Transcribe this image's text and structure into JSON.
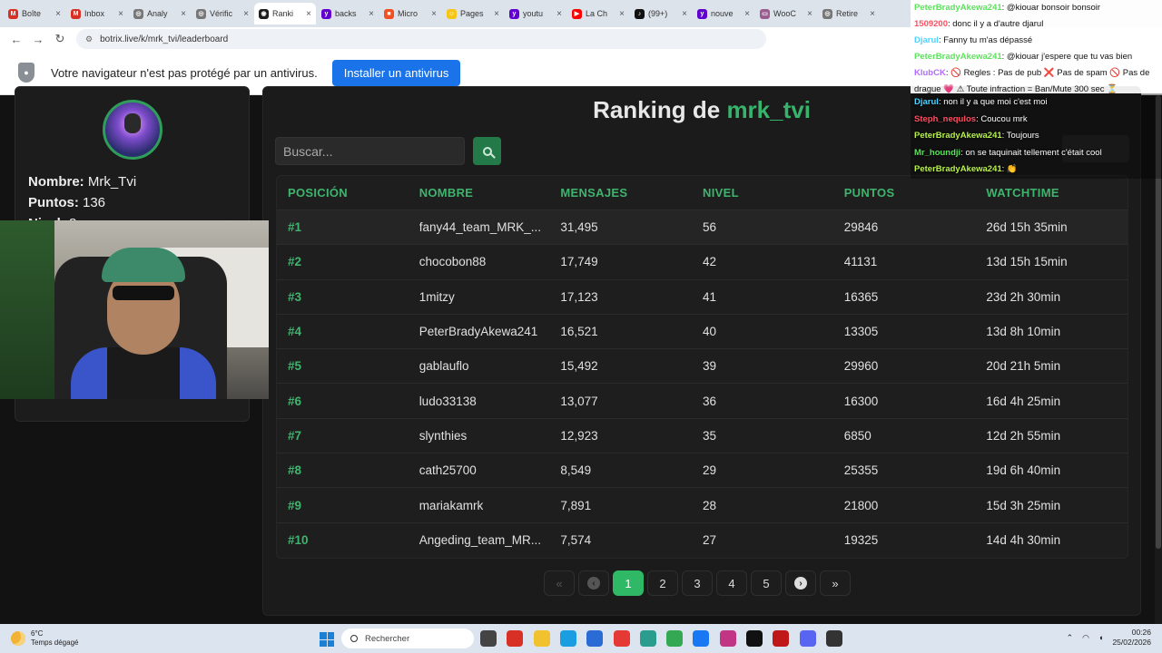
{
  "browser": {
    "tabs": [
      {
        "label": "Boîte",
        "fav_color": "#d93025",
        "glyph": "M"
      },
      {
        "label": "Inbox",
        "fav_color": "#d93025",
        "glyph": "M"
      },
      {
        "label": "Analy",
        "fav_color": "#777777",
        "glyph": "◎"
      },
      {
        "label": "Vérific",
        "fav_color": "#777777",
        "glyph": "◎"
      },
      {
        "label": "Ranki",
        "fav_color": "#1d1d1d",
        "glyph": "◉",
        "active": true
      },
      {
        "label": "backs",
        "fav_color": "#6001d2",
        "glyph": "y"
      },
      {
        "label": "Micro",
        "fav_color": "#f25022",
        "glyph": "■"
      },
      {
        "label": "Pages",
        "fav_color": "#f5c518",
        "glyph": "☺"
      },
      {
        "label": "youtu",
        "fav_color": "#6001d2",
        "glyph": "y"
      },
      {
        "label": "La Ch",
        "fav_color": "#ff0000",
        "glyph": "▶"
      },
      {
        "label": "(99+)",
        "fav_color": "#111111",
        "glyph": "♪"
      },
      {
        "label": "nouve",
        "fav_color": "#6001d2",
        "glyph": "y"
      },
      {
        "label": "WooC",
        "fav_color": "#9b5c8f",
        "glyph": "▭"
      },
      {
        "label": "Retire",
        "fav_color": "#777777",
        "glyph": "◎"
      }
    ],
    "url": "botrix.live/k/mrk_tvi/leaderboard"
  },
  "warning": {
    "text": "Votre navigateur n'est pas protégé par un antivirus.",
    "button": "Installer un antivirus"
  },
  "profile": {
    "name_label": "Nombre:",
    "name_value": "Mrk_Tvi",
    "points_label": "Puntos:",
    "points_value": "136",
    "level_label": "Nivel:",
    "level_value": "8"
  },
  "ranking": {
    "title_prefix": "Ranking de",
    "user": "mrk_tvi",
    "search_placeholder": "Buscar...",
    "headers": [
      "POSICIÓN",
      "NOMBRE",
      "MENSAJES",
      "NIVEL",
      "PUNTOS",
      "WATCHTIME"
    ],
    "rows": [
      {
        "pos": "#1",
        "name": "fany44_team_MRK_...",
        "msgs": "31,495",
        "level": "56",
        "points": "29846",
        "watch": "26d 15h 35min"
      },
      {
        "pos": "#2",
        "name": "chocobon88",
        "msgs": "17,749",
        "level": "42",
        "points": "41131",
        "watch": "13d 15h 15min"
      },
      {
        "pos": "#3",
        "name": "1mitzy",
        "msgs": "17,123",
        "level": "41",
        "points": "16365",
        "watch": "23d 2h 30min"
      },
      {
        "pos": "#4",
        "name": "PeterBradyAkewa241",
        "msgs": "16,521",
        "level": "40",
        "points": "13305",
        "watch": "13d 8h 10min"
      },
      {
        "pos": "#5",
        "name": "gablauflo",
        "msgs": "15,492",
        "level": "39",
        "points": "29960",
        "watch": "20d 21h 5min"
      },
      {
        "pos": "#6",
        "name": "ludo33138",
        "msgs": "13,077",
        "level": "36",
        "points": "16300",
        "watch": "16d 4h 25min"
      },
      {
        "pos": "#7",
        "name": "slynthies",
        "msgs": "12,923",
        "level": "35",
        "points": "6850",
        "watch": "12d 2h 55min"
      },
      {
        "pos": "#8",
        "name": "cath25700",
        "msgs": "8,549",
        "level": "29",
        "points": "25355",
        "watch": "19d 6h 40min"
      },
      {
        "pos": "#9",
        "name": "mariakamrk",
        "msgs": "7,891",
        "level": "28",
        "points": "21800",
        "watch": "15d 3h 25min"
      },
      {
        "pos": "#10",
        "name": "Angeding_team_MR...",
        "msgs": "7,574",
        "level": "27",
        "points": "19325",
        "watch": "14d 4h 30min"
      }
    ],
    "pagination": {
      "first": "«",
      "prev": "‹",
      "pages": [
        "1",
        "2",
        "3",
        "4",
        "5"
      ],
      "active": "1",
      "next": "›",
      "last": "»"
    }
  },
  "chat_top": [
    {
      "user": "PeterBradyAkewa241",
      "text": ": @kiouar bonsoir bonsoir",
      "ucls": "u-green"
    },
    {
      "user": "1509200",
      "text": ": donc il y a d'autre djarul",
      "ucls": "u-red"
    },
    {
      "user": "Djarul",
      "text": ": Fanny tu m'as dépassé",
      "ucls": "u-cyan"
    },
    {
      "user": "PeterBradyAkewa241",
      "text": ": @kiouar j'espere que tu vas bien",
      "ucls": "u-green"
    },
    {
      "user": "KlubCK",
      "text": ": 🚫 Regles : Pas de pub ❌ Pas de spam 🚫 Pas de",
      "ucls": "u-purple"
    },
    {
      "user": "",
      "text": "drague 💗 ⚠ Toute infraction = Ban/Mute 300 sec ⏳",
      "ucls": ""
    }
  ],
  "chat_bottom": [
    {
      "user": "Djarul",
      "text": ": non il y a que moi c'est moi",
      "ucls": "u-cyan"
    },
    {
      "user": "Steph_nequlos",
      "text": ": Coucou mrk",
      "ucls": "u-red"
    },
    {
      "user": "PeterBradyAkewa241",
      "text": ": Toujours",
      "ucls": "u-lime"
    },
    {
      "user": "Mr_houndji",
      "text": ": on se taquinait tellement c'était cool",
      "ucls": "u-green"
    },
    {
      "user": "PeterBradyAkewa241",
      "text": ": 👏",
      "ucls": "u-lime"
    }
  ],
  "taskbar": {
    "temp": "6°C",
    "weather": "Temps dégagé",
    "search": "Rechercher",
    "time": "00:26",
    "date": "25/02/2026",
    "icons": [
      {
        "name": "task-view-icon",
        "color": "#444444"
      },
      {
        "name": "chrome-alt-icon",
        "color": "#d93025"
      },
      {
        "name": "file-explorer-icon",
        "color": "#f2c12e"
      },
      {
        "name": "edge-icon",
        "color": "#1b9de2"
      },
      {
        "name": "store-icon",
        "color": "#2b6cd4"
      },
      {
        "name": "app-red-icon",
        "color": "#e53935"
      },
      {
        "name": "app-teal-icon",
        "color": "#2a9d8f"
      },
      {
        "name": "chrome-icon",
        "color": "#34a853"
      },
      {
        "name": "facebook-icon",
        "color": "#1877f2"
      },
      {
        "name": "instagram-icon",
        "color": "#c13584"
      },
      {
        "name": "tiktok-icon",
        "color": "#111111"
      },
      {
        "name": "mcafee-icon",
        "color": "#c01818"
      },
      {
        "name": "discord-icon",
        "color": "#5865f2"
      },
      {
        "name": "terminal-icon",
        "color": "#333333"
      }
    ]
  },
  "colors": {
    "accent": "#3fb46e",
    "active_page": "#2fb866"
  }
}
